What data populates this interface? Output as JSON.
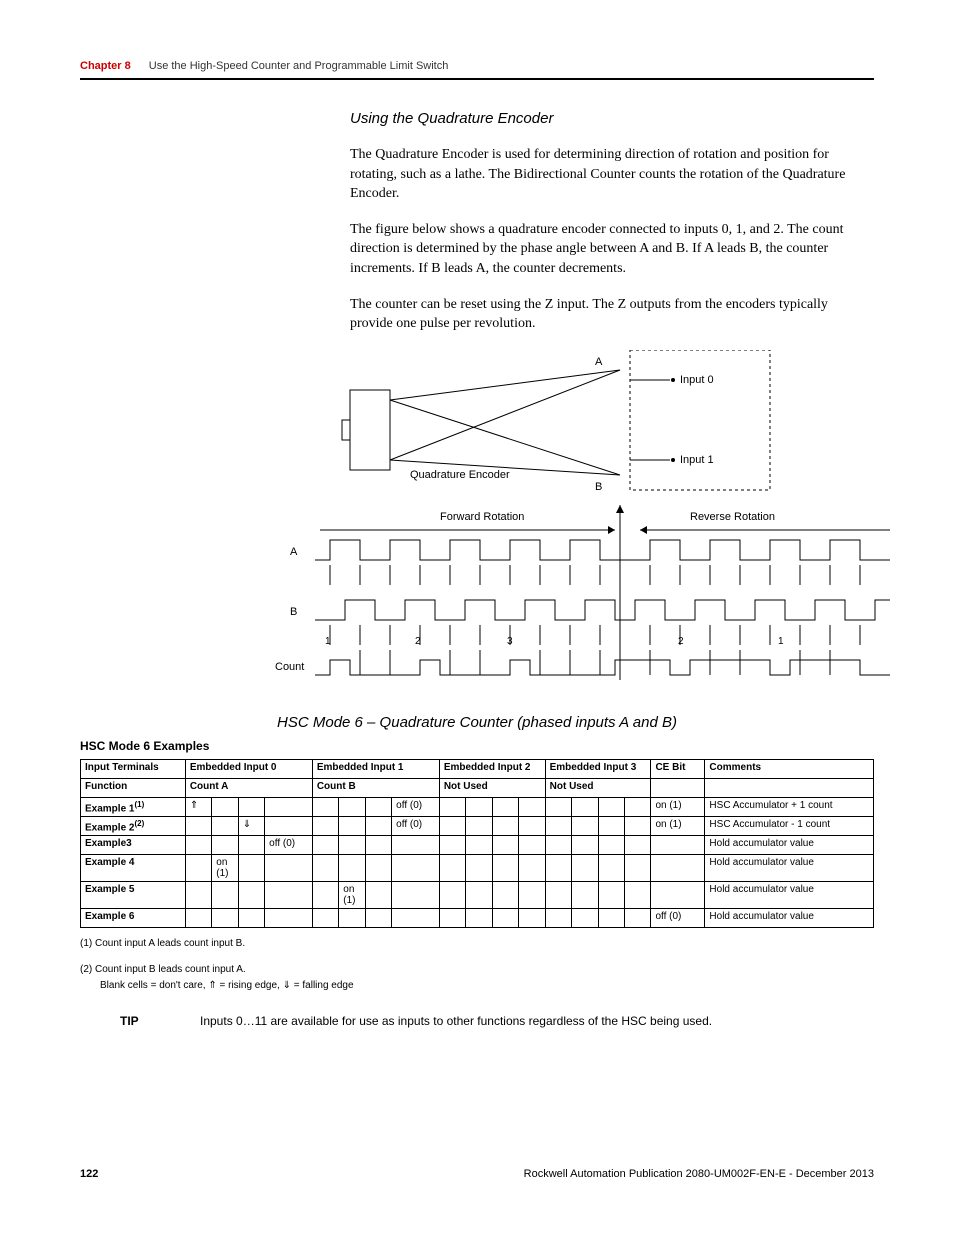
{
  "header": {
    "chapter": "Chapter 8",
    "title": "Use the High-Speed Counter and Programmable Limit Switch"
  },
  "section_title": "Using the Quadrature Encoder",
  "paragraphs": {
    "p1": "The Quadrature Encoder is used for determining direction of rotation and position for rotating, such as a lathe. The Bidirectional Counter counts the rotation of the Quadrature Encoder.",
    "p2": "The figure below shows a quadrature encoder connected to inputs 0, 1, and 2. The count direction is determined by the phase angle between A and B. If A leads B, the counter increments. If B leads A, the counter decrements.",
    "p3": "The counter can be reset using the Z input. The Z outputs from the encoders typically provide one pulse per revolution."
  },
  "diagram": {
    "A": "A",
    "B": "B",
    "input0": "Input 0",
    "input1": "Input 1",
    "quad": "Quadrature Encoder",
    "forward": "Forward Rotation",
    "reverse": "Reverse Rotation",
    "count": "Count",
    "labels": [
      "A",
      "B"
    ],
    "ticks": {
      "t1": "1",
      "t2": "2",
      "t3": "3"
    }
  },
  "mode_title": "HSC Mode 6 – Quadrature Counter (phased inputs A and B)",
  "examples_heading": "HSC Mode 6 Examples",
  "table": {
    "headers": {
      "input_terminals": "Input Terminals",
      "emb0": "Embedded Input 0",
      "emb1": "Embedded Input 1",
      "emb2": "Embedded Input 2",
      "emb3": "Embedded Input 3",
      "cebit": "CE Bit",
      "comments": "Comments"
    },
    "subheaders": {
      "function": "Function",
      "countA": "Count A",
      "countB": "Count B",
      "notused1": "Not Used",
      "notused2": "Not Used"
    },
    "rows": [
      {
        "name": "Example 1",
        "sup": "(1)",
        "c": [
          "⇑",
          "",
          "",
          "",
          "",
          "",
          "",
          "off (0)",
          "",
          "",
          "",
          "",
          "",
          "",
          "",
          "",
          "on (1)"
        ],
        "comment": "HSC Accumulator + 1 count"
      },
      {
        "name": "Example 2",
        "sup": "(2)",
        "c": [
          "",
          "",
          "⇓",
          "",
          "",
          "",
          "",
          "off (0)",
          "",
          "",
          "",
          "",
          "",
          "",
          "",
          "",
          "on (1)"
        ],
        "comment": "HSC Accumulator - 1 count"
      },
      {
        "name": "Example3",
        "sup": "",
        "c": [
          "",
          "",
          "",
          "off (0)",
          "",
          "",
          "",
          "",
          "",
          "",
          "",
          "",
          "",
          "",
          "",
          "",
          ""
        ],
        "comment": "Hold accumulator value"
      },
      {
        "name": "Example 4",
        "sup": "",
        "c": [
          "",
          "on (1)",
          "",
          "",
          "",
          "",
          "",
          "",
          "",
          "",
          "",
          "",
          "",
          "",
          "",
          "",
          ""
        ],
        "comment": "Hold accumulator value"
      },
      {
        "name": "Example 5",
        "sup": "",
        "c": [
          "",
          "",
          "",
          "",
          "",
          "on (1)",
          "",
          "",
          "",
          "",
          "",
          "",
          "",
          "",
          "",
          "",
          ""
        ],
        "comment": "Hold accumulator value"
      },
      {
        "name": "Example 6",
        "sup": "",
        "c": [
          "",
          "",
          "",
          "",
          "",
          "",
          "",
          "",
          "",
          "",
          "",
          "",
          "",
          "",
          "",
          "",
          "off (0)"
        ],
        "comment": "Hold accumulator value"
      }
    ]
  },
  "footnotes": {
    "f1": "(1)  Count input A leads count input B.",
    "f2": "(2)  Count input B leads count input A.",
    "f3": "Blank cells = don't care, ⇑ = rising edge, ⇓ = falling edge"
  },
  "tip": {
    "label": "TIP",
    "text": "Inputs 0…11 are available for use as inputs to other functions regardless of the HSC being used."
  },
  "footer": {
    "page": "122",
    "pub": "Rockwell Automation Publication 2080-UM002F-EN-E - December 2013"
  }
}
